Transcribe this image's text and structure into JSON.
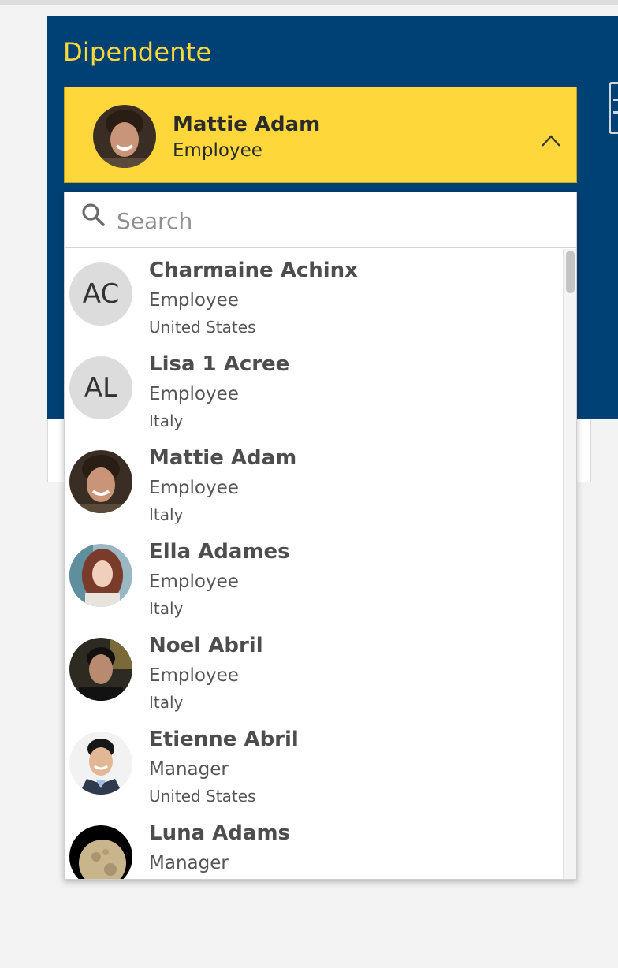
{
  "panel": {
    "title": "Dipendente"
  },
  "selected": {
    "name": "Mattie Adam",
    "role": "Employee"
  },
  "search": {
    "placeholder": "Search",
    "value": ""
  },
  "employees": [
    {
      "initials": "AC",
      "name": "Charmaine Achinx",
      "role": "Employee",
      "country": "United States",
      "avatar": "initials"
    },
    {
      "initials": "AL",
      "name": "Lisa 1 Acree",
      "role": "Employee",
      "country": "Italy",
      "avatar": "initials"
    },
    {
      "name": "Mattie Adam",
      "role": "Employee",
      "country": "Italy",
      "avatar": "photo-man-smiling"
    },
    {
      "name": "Ella Adames",
      "role": "Employee",
      "country": "Italy",
      "avatar": "photo-woman-red-hair"
    },
    {
      "name": "Noel Abril",
      "role": "Employee",
      "country": "Italy",
      "avatar": "photo-man-dark-hair"
    },
    {
      "name": "Etienne Abril",
      "role": "Manager",
      "country": "United States",
      "avatar": "photo-man-suit"
    },
    {
      "name": "Luna Adams",
      "role": "Manager",
      "country": "",
      "avatar": "photo-moon"
    }
  ],
  "colors": {
    "panel_bg": "#004175",
    "title": "#ffd83a",
    "selector_bg": "#fed73b",
    "initials_bg": "#dcdcdc"
  },
  "icons": {
    "search": "search-icon",
    "chevron": "chevron-up-icon",
    "right_edge": "calendar-icon"
  }
}
